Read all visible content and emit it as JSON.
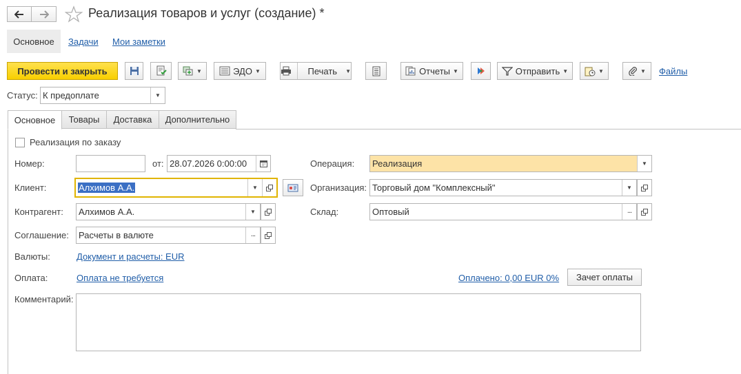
{
  "window": {
    "title": "Реализация товаров и услуг (создание) *"
  },
  "topnav": {
    "main": "Основное",
    "tasks": "Задачи",
    "notes": "Мои заметки"
  },
  "toolbar": {
    "post_close": "Провести и закрыть",
    "edo": "ЭДО",
    "print": "Печать",
    "reports": "Отчеты",
    "send": "Отправить",
    "files": "Файлы"
  },
  "status": {
    "label": "Статус:",
    "value": "К предоплате"
  },
  "tabs": [
    {
      "label": "Основное"
    },
    {
      "label": "Товары"
    },
    {
      "label": "Доставка"
    },
    {
      "label": "Дополнительно"
    }
  ],
  "form": {
    "by_order_label": "Реализация по заказу",
    "number_label": "Номер:",
    "number_value": "",
    "from_label": "от:",
    "date_value": "28.07.2026  0:00:00",
    "client_label": "Клиент:",
    "client_value": "Алхимов А.А.",
    "counterparty_label": "Контрагент:",
    "counterparty_value": "Алхимов А.А.",
    "agreement_label": "Соглашение:",
    "agreement_value": "Расчеты в валюте",
    "currency_label": "Валюты:",
    "currency_link": "Документ и расчеты: EUR",
    "payment_label": "Оплата:",
    "payment_link": "Оплата не требуется",
    "paid_link": "Оплачено: 0,00 EUR 0%",
    "offset_button": "Зачет оплаты",
    "comment_label": "Комментарий:",
    "comment_value": "",
    "operation_label": "Операция:",
    "operation_value": "Реализация",
    "organization_label": "Организация:",
    "organization_value": "Торговый дом \"Комплексный\"",
    "warehouse_label": "Склад:",
    "warehouse_value": "Оптовый"
  },
  "colors": {
    "accent_yellow": "#f8cf00",
    "link": "#1f5da8",
    "highlight_field": "#fde3a7",
    "focus_border": "#e0b400",
    "selection": "#3b6fc4"
  }
}
